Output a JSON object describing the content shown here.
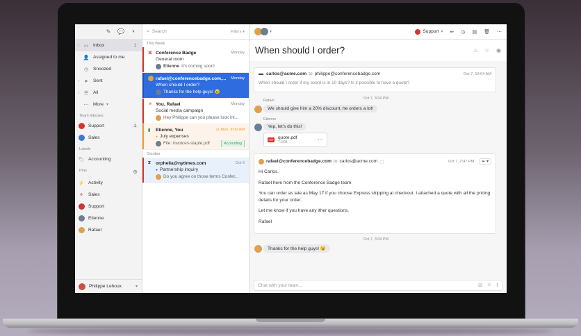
{
  "sidebar": {
    "items": [
      {
        "label": "Inbox",
        "count": "1"
      },
      {
        "label": "Assigned to me"
      },
      {
        "label": "Snoozed"
      },
      {
        "label": "Sent"
      },
      {
        "label": "All"
      },
      {
        "label": "More"
      }
    ],
    "team_inboxes_label": "Team Inboxes",
    "team_inboxes": [
      {
        "label": "Support",
        "count": "1"
      },
      {
        "label": "Sales"
      }
    ],
    "labels_label": "Labels",
    "labels": [
      {
        "label": "Accounting"
      }
    ],
    "pins_label": "Pins",
    "pins": [
      {
        "label": "Activity"
      },
      {
        "label": "Sales"
      },
      {
        "label": "Support"
      },
      {
        "label": "Etienne"
      },
      {
        "label": "Rafael"
      }
    ],
    "user": "Philippe Lehoux"
  },
  "list": {
    "search_placeholder": "Search",
    "filters": "Filters",
    "this_week": "This Week",
    "october": "October",
    "messages": [
      {
        "from": "Conference Badge",
        "date": "Monday",
        "subject": "General room",
        "preview_author": "Etienne",
        "preview": "It's coming soon!"
      },
      {
        "from": "rafael@conferencebadge.com,...",
        "date": "Monday",
        "subject": "When should I order?",
        "preview": "Thanks for the help guys! 😉"
      },
      {
        "from": "You, Rafael",
        "date": "Monday",
        "subject": "Social media campaign",
        "preview": "Hey Philippe can you please look int..."
      },
      {
        "from": "Etienne, You",
        "date": "Mon, 8:00 AM",
        "subject": "July expenses",
        "preview": "File: invoices-staple.pdf",
        "tag": "Accounting"
      },
      {
        "from": "orphelia@nytimes.com",
        "date": "Oct 6",
        "subject": "Partnership inquiry",
        "preview": "Do you agree on those terms Confer..."
      }
    ]
  },
  "conversation": {
    "inbox_label": "Support",
    "subject": "When should I order?",
    "first_email": {
      "from": "carlos@acme.com",
      "to_word": "to",
      "to": "philippe@conferencebadge.com",
      "date": "Oct 7, 10:04 AM",
      "snippet": "When should I order if my event is in 10 days? Is it possible to have a quote?"
    },
    "chat1": {
      "meta": "Rafael",
      "time": "Oct 7, 3:04 PM",
      "text": "We should give him a 20% discount, he orders a lot!"
    },
    "chat2": {
      "meta": "Etienne",
      "text": "Yep, let's do this!"
    },
    "attachment": {
      "name": "quote.pdf",
      "size": "7.6KB",
      "type": "PDF"
    },
    "reply": {
      "from": "rafael@conferencebadge.com",
      "to_word": "to",
      "to": "carlos@acme.com",
      "date": "Oct 7, 2:47 PM",
      "greeting": "Hi Carlos,",
      "p1": "Rafael here from the Conference Badge team",
      "p2": "You can order as late as May 17 if you choose Express shipping at checkout. I attached a quote with all the pricing details for your order.",
      "p3": "Let me know if you have any ither questions.",
      "sign": "Rafael"
    },
    "chat3": {
      "time": "Oct 7, 3:04 PM",
      "text": "Thanks for the help guys! 😉"
    },
    "composer_placeholder": "Chat with your team..."
  },
  "colors": {
    "accent": "#2f6ce0",
    "red": "#d5352e",
    "orange": "#f39c34",
    "green": "#3a9a59"
  }
}
